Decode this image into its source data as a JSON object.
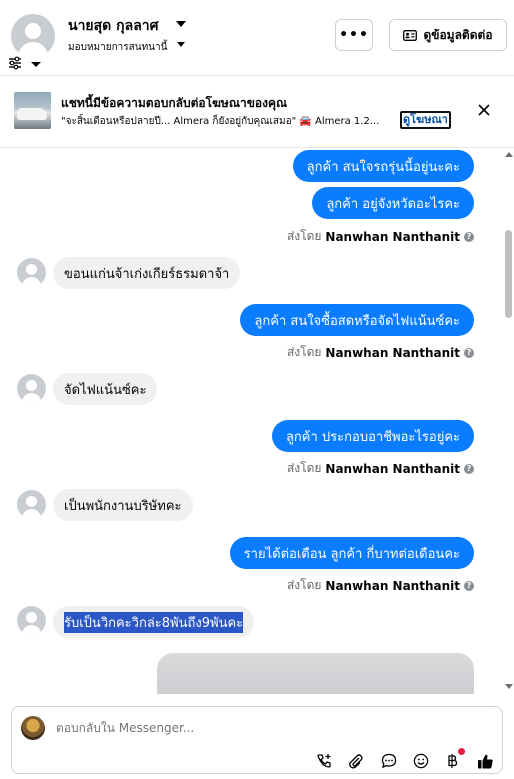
{
  "header": {
    "contact_name": "นายสุด กุลลาศ",
    "assign_label": "มอบหมายการสนทนานี้",
    "more_label": "•••",
    "contact_info_label": "ดูข้อมูลติดต่อ"
  },
  "ad_banner": {
    "title": "แชทนี้มีข้อความตอบกลับต่อโฆษณาของคุณ",
    "preview": "\"จะสิ้นเดือนหรือปลายปี... Almera ก็ยังอยู่กับคุณเสมอ\" 🚘 Almera 1.2...",
    "link_label": "ดูโฆษณา"
  },
  "messages": [
    {
      "dir": "out",
      "text": "ลูกค้า สนใจรถรุ่นนี้อยู่นะคะ"
    },
    {
      "dir": "out",
      "text": "ลูกค้า อยู่จังหวัดอะไรคะ"
    },
    {
      "dir": "meta",
      "prefix": "ส่งโดย",
      "sender": "Nanwhan Nanthanit"
    },
    {
      "dir": "in",
      "text": "ขอนแก่นจ้าเก่งเกียร์ธรมดาจ้า"
    },
    {
      "dir": "out",
      "text": "ลูกค้า สนใจซื้อสดหรือจัดไฟแน้นซ์คะ"
    },
    {
      "dir": "meta",
      "prefix": "ส่งโดย",
      "sender": "Nanwhan Nanthanit"
    },
    {
      "dir": "in",
      "text": "จัดไฟแน้นซ์คะ"
    },
    {
      "dir": "out",
      "text": "ลูกค้า ประกอบอาชีพอะไรอยู่คะ"
    },
    {
      "dir": "meta",
      "prefix": "ส่งโดย",
      "sender": "Nanwhan Nanthanit"
    },
    {
      "dir": "in",
      "text": "เป็นพนักงานบริษัทคะ"
    },
    {
      "dir": "out",
      "text": "รายได้ต่อเดือน ลูกค้า กี่บาทต่อเดือนคะ"
    },
    {
      "dir": "meta",
      "prefix": "ส่งโดย",
      "sender": "Nanwhan Nanthanit"
    },
    {
      "dir": "in",
      "text": "รับเป็นวิกคะวิกล่ะ8พันถึง9พันคะ"
    }
  ],
  "composer": {
    "placeholder": "ตอบกลับใน Messenger..."
  },
  "colors": {
    "outgoing_bubble": "#0a7cff",
    "incoming_bubble": "#f0f0f0",
    "selection": "#2b56c6",
    "notification_dot": "#e41e3f"
  }
}
